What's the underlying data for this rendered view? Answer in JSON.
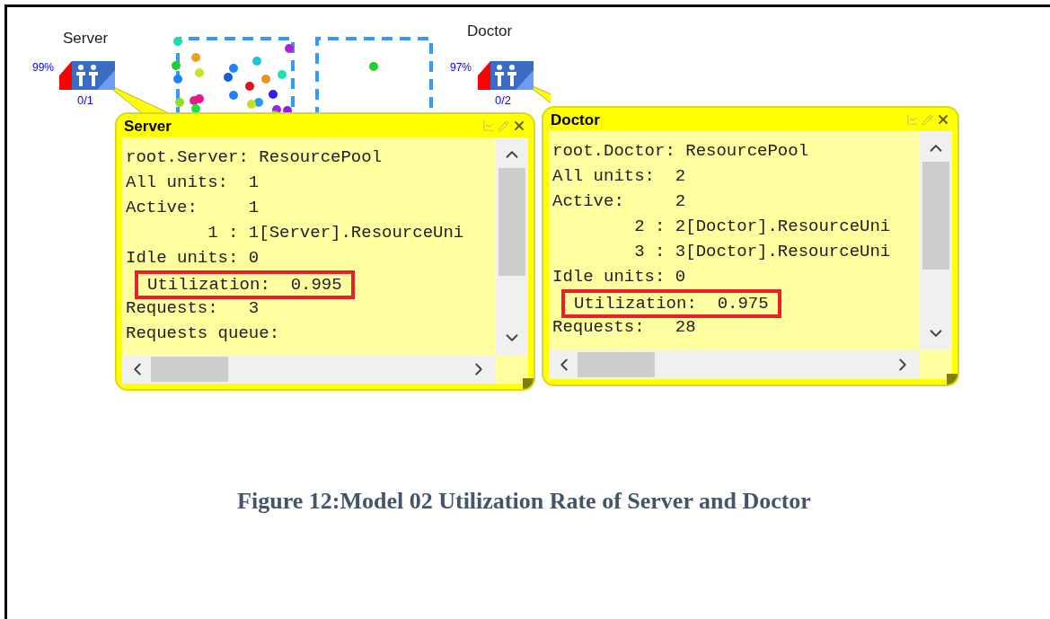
{
  "resource_pools": [
    {
      "name": "Server",
      "percent": "99%",
      "units": "0/1"
    },
    {
      "name": "Doctor",
      "percent": "97%",
      "units": "0/2"
    }
  ],
  "inspect_windows": [
    {
      "title": "Server",
      "lines": [
        {
          "text": "root.Server: ResourcePool",
          "highlighted": false
        },
        {
          "text": "All units:  1",
          "highlighted": false
        },
        {
          "text": "Active:     1",
          "highlighted": false
        },
        {
          "text": "        1 : 1[Server].ResourceUni",
          "highlighted": false
        },
        {
          "text": "Idle units: 0",
          "highlighted": false
        },
        {
          "text": "Utilization:  0.995",
          "highlighted": true
        },
        {
          "text": "Requests:   3",
          "highlighted": false
        },
        {
          "text": "Requests queue:",
          "highlighted": false
        }
      ]
    },
    {
      "title": "Doctor",
      "lines": [
        {
          "text": "root.Doctor: ResourcePool",
          "highlighted": false
        },
        {
          "text": "All units:  2",
          "highlighted": false
        },
        {
          "text": "Active:     2",
          "highlighted": false
        },
        {
          "text": "        2 : 2[Doctor].ResourceUni",
          "highlighted": false
        },
        {
          "text": "        3 : 3[Doctor].ResourceUni",
          "highlighted": false
        },
        {
          "text": "Idle units: 0",
          "highlighted": false
        },
        {
          "text": "Utilization:  0.975",
          "highlighted": true
        },
        {
          "text": "Requests:   28",
          "highlighted": false
        }
      ]
    }
  ],
  "caption": "Figure 12:Model 02 Utilization Rate of Server and Doctor"
}
